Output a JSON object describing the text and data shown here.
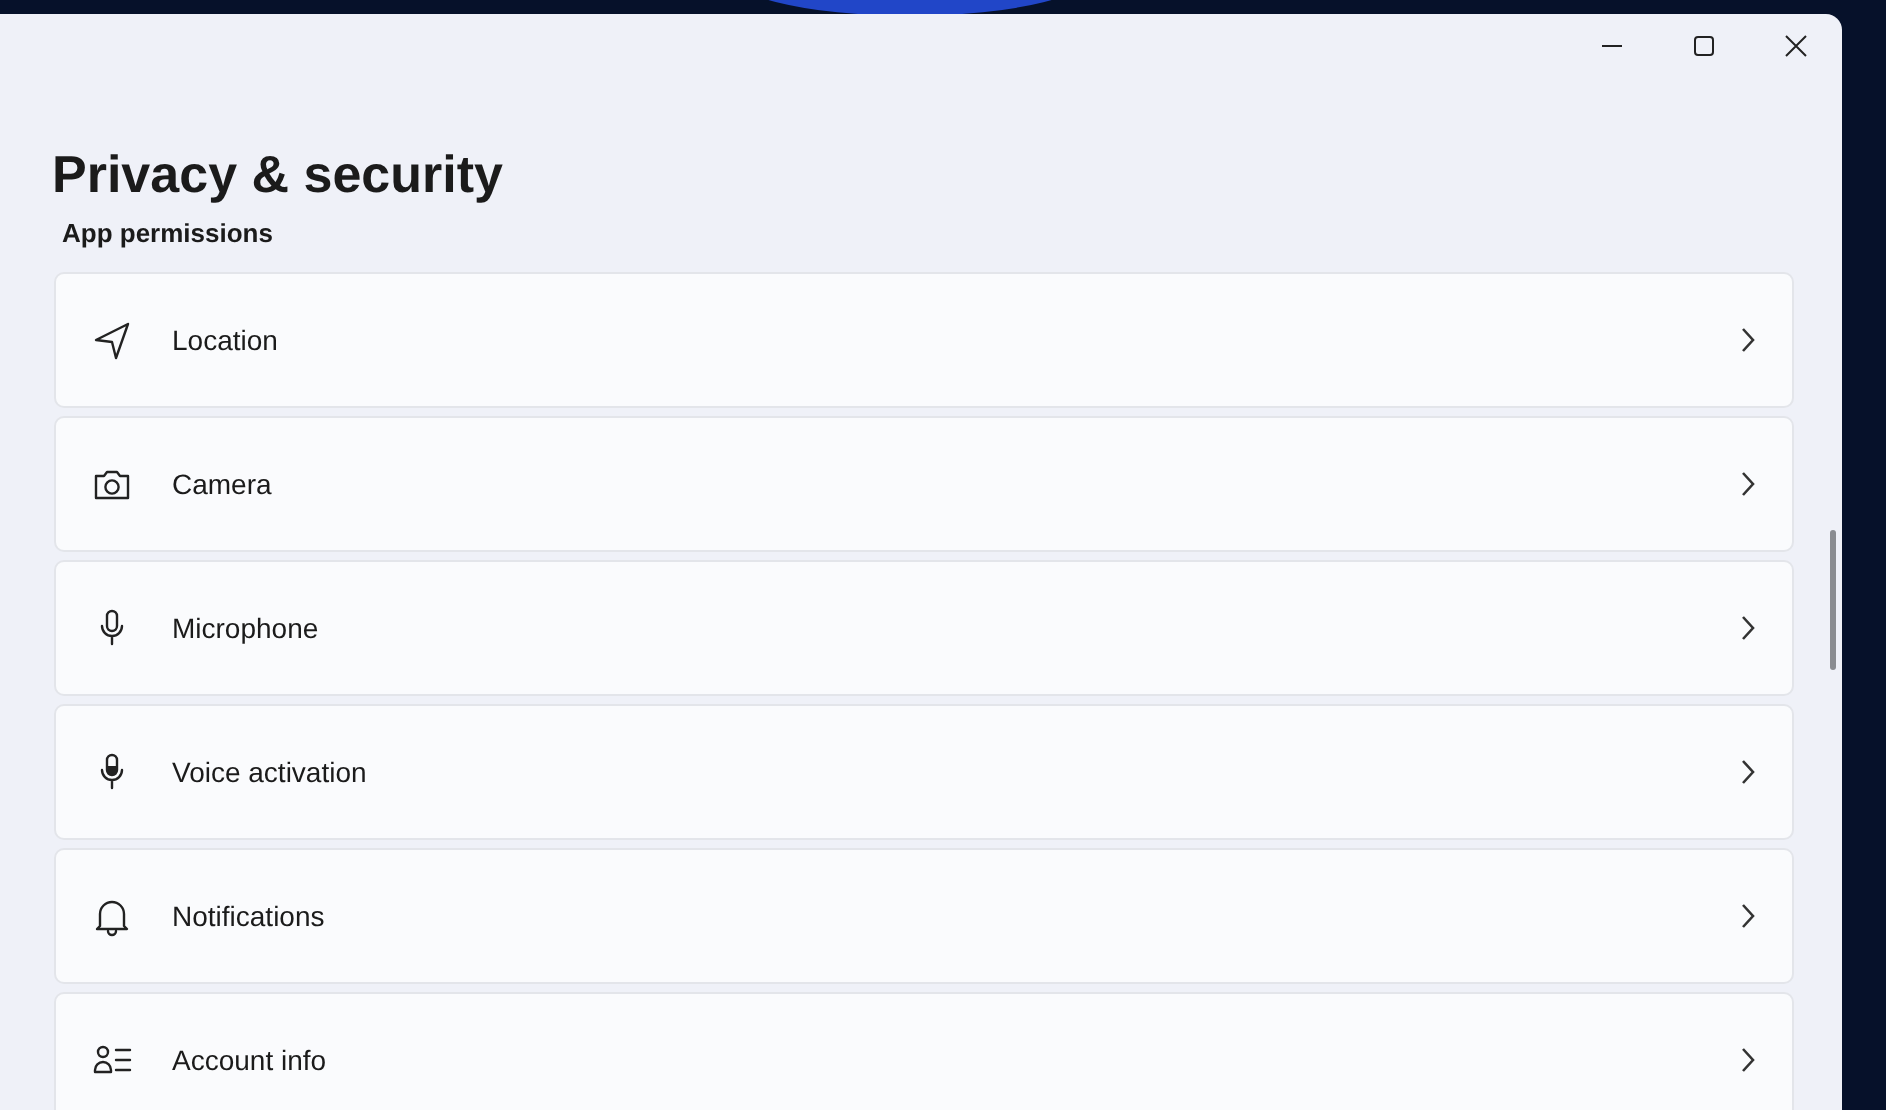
{
  "window": {
    "title": "Privacy & security"
  },
  "section": {
    "label": "App permissions"
  },
  "items": [
    {
      "label": "Location"
    },
    {
      "label": "Camera"
    },
    {
      "label": "Microphone"
    },
    {
      "label": "Voice activation"
    },
    {
      "label": "Notifications"
    },
    {
      "label": "Account info"
    }
  ]
}
